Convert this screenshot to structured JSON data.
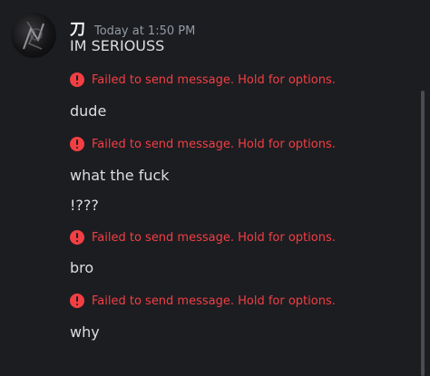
{
  "message": {
    "author": {
      "name": "刀",
      "avatar_icon": "avatar-image"
    },
    "timestamp": "Today at 1:50 PM",
    "lines": [
      {
        "text": "IM SERIOUSS",
        "error": "Failed to send message. Hold for options."
      },
      {
        "text": "dude",
        "error": "Failed to send message. Hold for options."
      },
      {
        "text": "what the fuck",
        "error": null
      },
      {
        "text": "!???",
        "error": "Failed to send message. Hold for options."
      },
      {
        "text": "bro",
        "error": "Failed to send message. Hold for options."
      },
      {
        "text": "why",
        "error": null
      }
    ]
  },
  "colors": {
    "background": "#1c1d21",
    "text": "#dbdee1",
    "error": "#f23f43",
    "timestamp": "#949ba4"
  }
}
